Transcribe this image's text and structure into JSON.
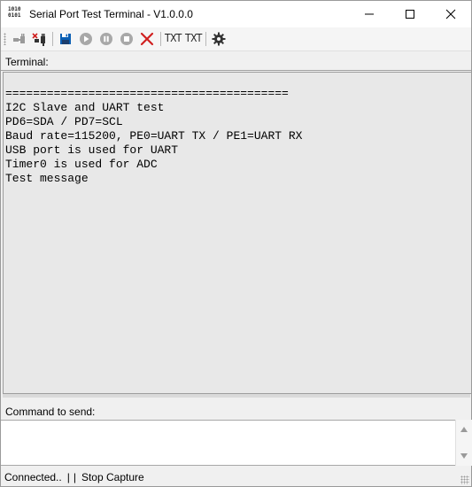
{
  "window": {
    "title": "Serial Port Test Terminal - V1.0.0.0",
    "icon_label": "1010\n0101"
  },
  "titlebar_buttons": {
    "minimize": "minimize-icon",
    "maximize": "maximize-icon",
    "close": "close-icon"
  },
  "toolbar": {
    "items": [
      {
        "name": "connect-icon"
      },
      {
        "name": "disconnect-icon"
      },
      {
        "name": "save-icon"
      },
      {
        "name": "play-icon"
      },
      {
        "name": "pause-icon"
      },
      {
        "name": "stop-icon"
      },
      {
        "name": "clear-icon"
      }
    ],
    "txt_button_1": "TXT",
    "txt_button_2": "TXT",
    "settings": "gear-icon"
  },
  "terminal": {
    "label": "Terminal:",
    "lines": [
      "",
      "=========================================",
      "I2C Slave and UART test",
      "PD6=SDA / PD7=SCL",
      "Baud rate=115200, PE0=UART TX / PE1=UART RX",
      "USB port is used for UART",
      "Timer0 is used for ADC",
      "Test message"
    ]
  },
  "command": {
    "label": "Command to send:",
    "value": ""
  },
  "status": {
    "connection": "Connected..",
    "sep1": "|",
    "sep2": "|",
    "capture": "Stop Capture"
  },
  "colors": {
    "accent_blue": "#0a5fb4",
    "stop_red": "#d02020",
    "disabled_gray": "#a8a8a8"
  }
}
